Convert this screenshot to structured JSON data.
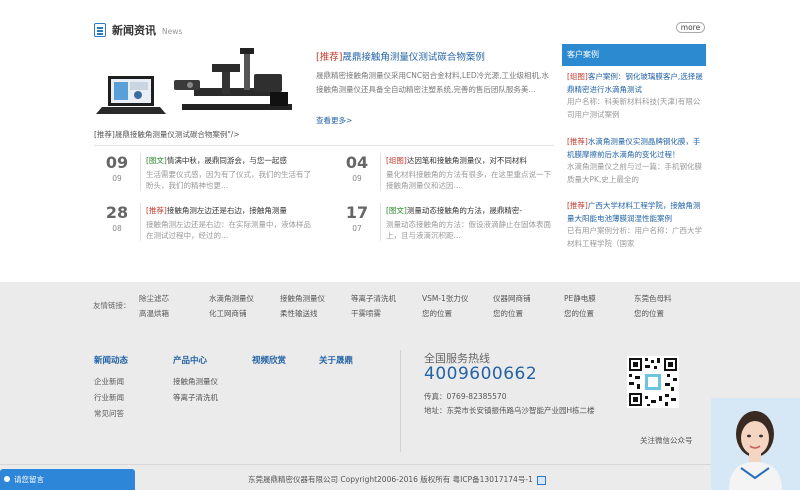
{
  "news": {
    "title": "新闻资讯",
    "subtitle": "News",
    "more": "more",
    "featured": {
      "tag": "[推荐]",
      "title": "晟鼎接触角测量仪测试碳合物案例",
      "body": "晟鼎精密接触角测量仪采用CNC铝合金材料,LED冷光源,工业级相机,水接触角测量仪还具备全自动精密注塑系统,完善的售后团队服务美...",
      "more": "查看更多>",
      "image_caption": "[推荐]晟鼎接触角测量仪测试碳合物案例\"/>"
    },
    "items": [
      {
        "day": "09",
        "mon": "09",
        "tag": "[图文]",
        "tag_color": "green",
        "title": "情满中秋，晟鼎同游会，与您一起感",
        "desc": "生活需要仪式感，因为有了仪式，我们的生活有了盼头，我们的精神也更..."
      },
      {
        "day": "04",
        "mon": "09",
        "tag": "[组图]",
        "tag_color": "red",
        "title": "达因笔和接触角测量仪，对不同材料",
        "desc": "量化材料接触角的方法有很多，在这里重点说一下接触角测量仪和达因..."
      },
      {
        "day": "28",
        "mon": "08",
        "tag": "[推荐]",
        "tag_color": "red",
        "title": "接触角测左边还是右边，接触角测量",
        "desc": "接触角测左边还是右边：在实际测量中，液体样品在测试过程中，经过的..."
      },
      {
        "day": "17",
        "mon": "07",
        "tag": "[图文]",
        "tag_color": "green",
        "title": "测量动态接触角的方法，晟鼎精密-",
        "desc": "测量动态接触角的方法：假设液滴静止在固体表面上，且与液滴沉积距..."
      }
    ]
  },
  "cases": {
    "title": "客户案例",
    "items": [
      {
        "tag": "[组图]",
        "title": "客户案例：钢化玻璃膜客户,选择晟鼎精密进行水滴角测试",
        "desc": "用户名称：科美新材料科技(天津)有限公司用户测试案例"
      },
      {
        "tag": "[推荐]",
        "title": "水滴角测量仪实测晶牌钢化膜，手机膜摩擦前后水滴角的变化过程！",
        "desc": "水滴角测量仪之前与过一篇：手机钢化膜质量大PK,史上最全的"
      },
      {
        "tag": "[推荐]",
        "title": "广西大学材料工程学院，接触角测量大阳能电池薄膜润湿性能案例",
        "desc": "已有用户案例分析：用户名称：广西大学材料工程学院（国家"
      }
    ]
  },
  "links": {
    "label": "友情链接：",
    "items": [
      "除尘滤芯",
      "水滴角测量仪",
      "接触角测量仪",
      "等离子清洗机",
      "VSM-1张力仪",
      "仪器网商铺",
      "PE静电膜",
      "东莞色母料",
      "高温烘箱",
      "化工网商铺",
      "柔性输送线",
      "干雾喷雾",
      "您的位置",
      "您的位置",
      "您的位置",
      "您的位置"
    ]
  },
  "footer": {
    "columns": [
      {
        "heading": "新闻动态",
        "items": [
          "企业新闻",
          "行业新闻",
          "常见问答"
        ]
      },
      {
        "heading": "产品中心",
        "items": [
          "接触角测量仪",
          "等离子清洗机"
        ]
      },
      {
        "heading": "视频欣赏",
        "items": []
      },
      {
        "heading": "关于晟鼎",
        "items": []
      }
    ],
    "hotline_label": "全国服务热线",
    "hotline_number": "4009600662",
    "fax": "传真：0769-82385570",
    "address": "地址：东莞市长安镇振伟路乌沙智能产业园H栋二楼",
    "qr_label": "关注微信公众号",
    "copyright": "东莞晟鼎精密仪器有限公司 Copyright2006-2016 版权所有 粤ICP备13017174号-1"
  },
  "widgets": {
    "message_button": "请您留言"
  },
  "colors": {
    "accent": "#2b8ad0",
    "link": "#2363a6",
    "tag_red": "#c0392b",
    "tag_green": "#2a8a2a",
    "band": "#ebebeb"
  }
}
